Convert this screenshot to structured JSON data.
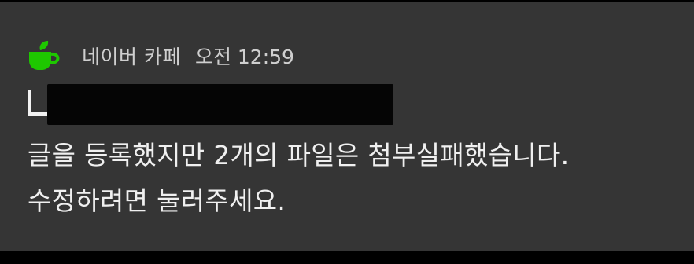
{
  "notification": {
    "app_name": "네이버 카페",
    "time": "오전 12:59",
    "title_redacted": true,
    "message_lines": [
      "글을 등록했지만 2개의 파일은 첨부실패했습니다.",
      "수정하려면 눌러주세요."
    ],
    "icon": "naver-cafe-cup-icon",
    "colors": {
      "accent": "#1ec800",
      "background": "#353535",
      "text": "#f0f0f0",
      "secondary_text": "#cfcfcf"
    }
  }
}
